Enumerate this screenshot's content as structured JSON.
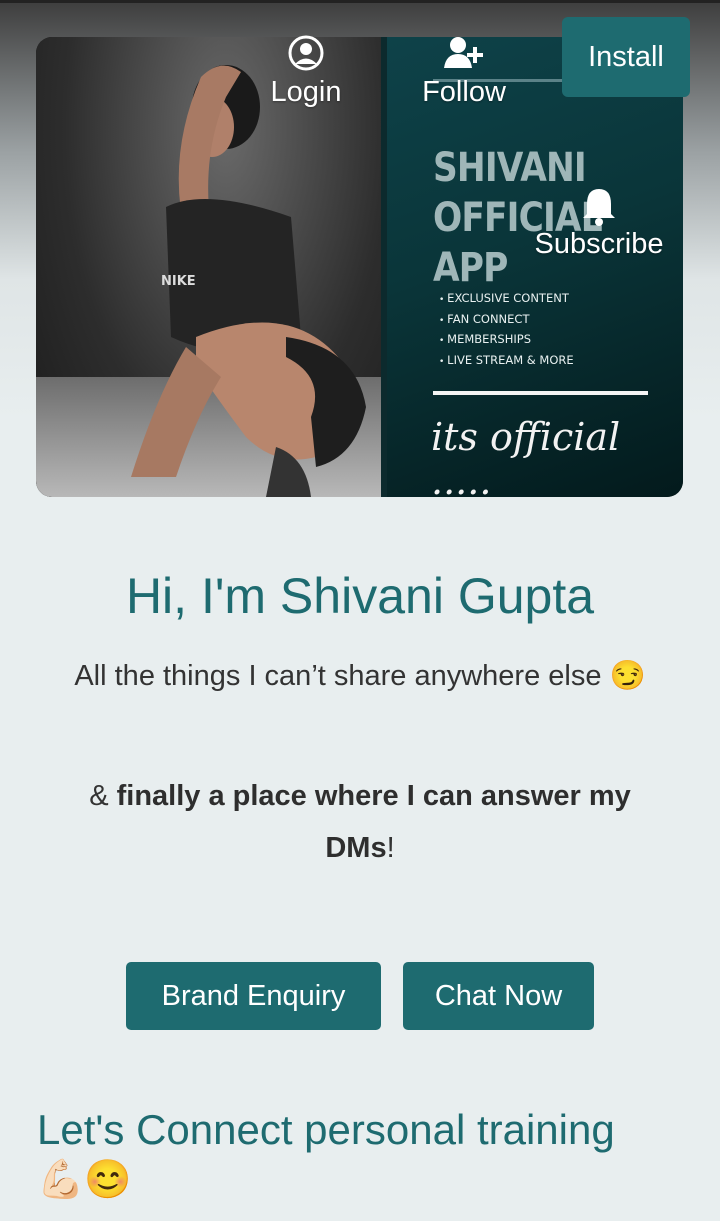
{
  "header": {
    "login_label": "Login",
    "follow_label": "Follow",
    "subscribe_label": "Subscribe",
    "install_label": "Install"
  },
  "banner": {
    "title_line1": "SHIVANI",
    "title_line2": "OFFICIAL APP",
    "features": [
      "EXCLUSIVE CONTENT",
      "FAN CONNECT",
      "MEMBERSHIPS",
      "LIVE STREAM & MORE"
    ],
    "script_text": "its official .....",
    "shirt_logo": "NIKE"
  },
  "profile": {
    "greeting": "Hi, I'm Shivani Gupta",
    "tagline_text": "All the things I can’t share anywhere else",
    "tagline_emoji": "😏",
    "tagline2_prefix": "& ",
    "tagline2_bold": "finally a place where I can answer my DMs",
    "tagline2_suffix": "!"
  },
  "actions": {
    "brand_enquiry": "Brand Enquiry",
    "chat_now": "Chat Now"
  },
  "section": {
    "title": "Let's Connect personal training",
    "emojis": "💪🏻😊"
  },
  "colors": {
    "accent": "#1e6b70",
    "background": "#e8eeef"
  }
}
